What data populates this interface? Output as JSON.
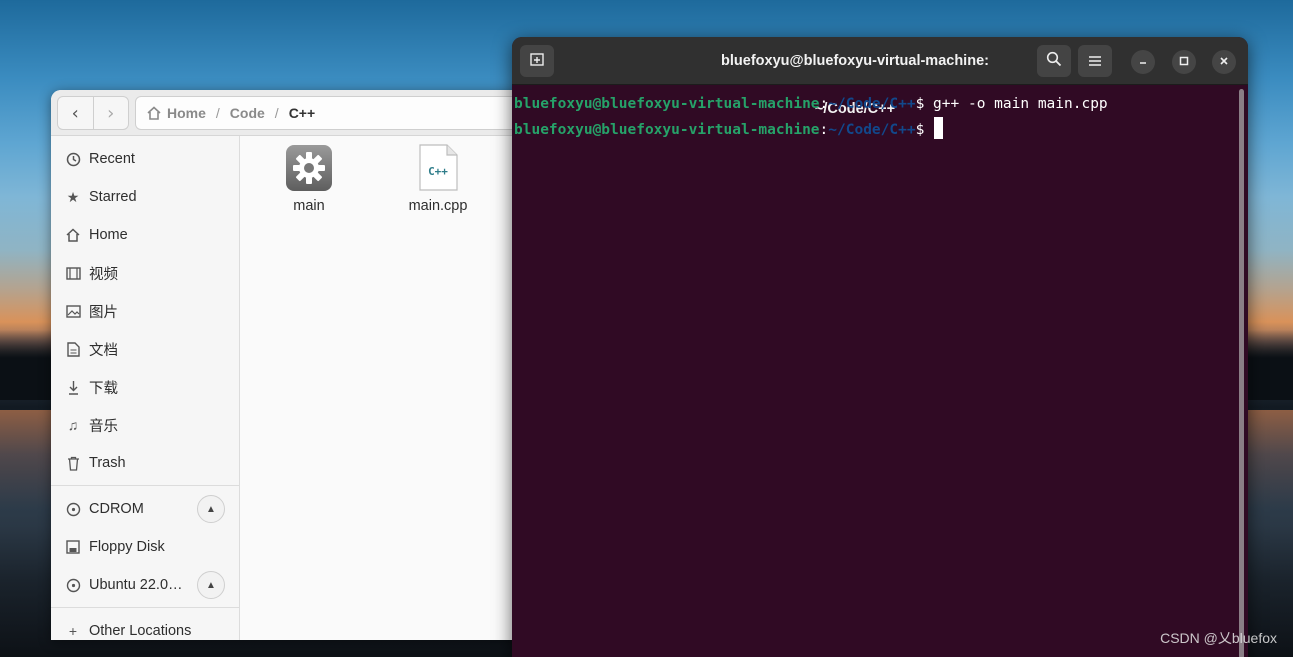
{
  "files_window": {
    "path": {
      "home": "Home",
      "segment": "Code",
      "current": "C++",
      "separator": "/"
    },
    "sidebar": {
      "places": [
        {
          "label": "Recent",
          "icon": "clock-icon"
        },
        {
          "label": "Starred",
          "icon": "star-icon"
        },
        {
          "label": "Home",
          "icon": "home-icon"
        },
        {
          "label": "视频",
          "icon": "video-icon"
        },
        {
          "label": "图片",
          "icon": "picture-icon"
        },
        {
          "label": "文档",
          "icon": "document-icon"
        },
        {
          "label": "下载",
          "icon": "download-icon"
        },
        {
          "label": "音乐",
          "icon": "music-icon"
        },
        {
          "label": "Trash",
          "icon": "trash-icon"
        }
      ],
      "devices": [
        {
          "label": "CDROM",
          "icon": "disc-icon",
          "eject": true
        },
        {
          "label": "Floppy Disk",
          "icon": "drive-icon",
          "eject": false
        },
        {
          "label": "Ubuntu 22.0…",
          "icon": "disc-icon",
          "eject": true
        }
      ],
      "other_locations": "Other Locations"
    },
    "files": [
      {
        "name": "main",
        "icon": "executable-gear-icon"
      },
      {
        "name": "main.cpp",
        "icon": "cpp-file-icon",
        "badge": "C++"
      }
    ]
  },
  "terminal": {
    "title": "bluefoxyu@bluefoxyu-virtual-machine: ~/Code/C++",
    "lines": [
      {
        "user": "bluefoxyu@bluefoxyu-virtual-machine",
        "colon": ":",
        "path": "~/Code/C++",
        "dollar": "$",
        "command": " g++ -o main main.cpp"
      },
      {
        "user": "bluefoxyu@bluefoxyu-virtual-machine",
        "colon": ":",
        "path": "~/Code/C++",
        "dollar": "$",
        "command": " "
      }
    ],
    "colors": {
      "background": "#300a24",
      "user": "#26a269",
      "path": "#12488b"
    }
  },
  "watermark": "CSDN @乂bluefox"
}
